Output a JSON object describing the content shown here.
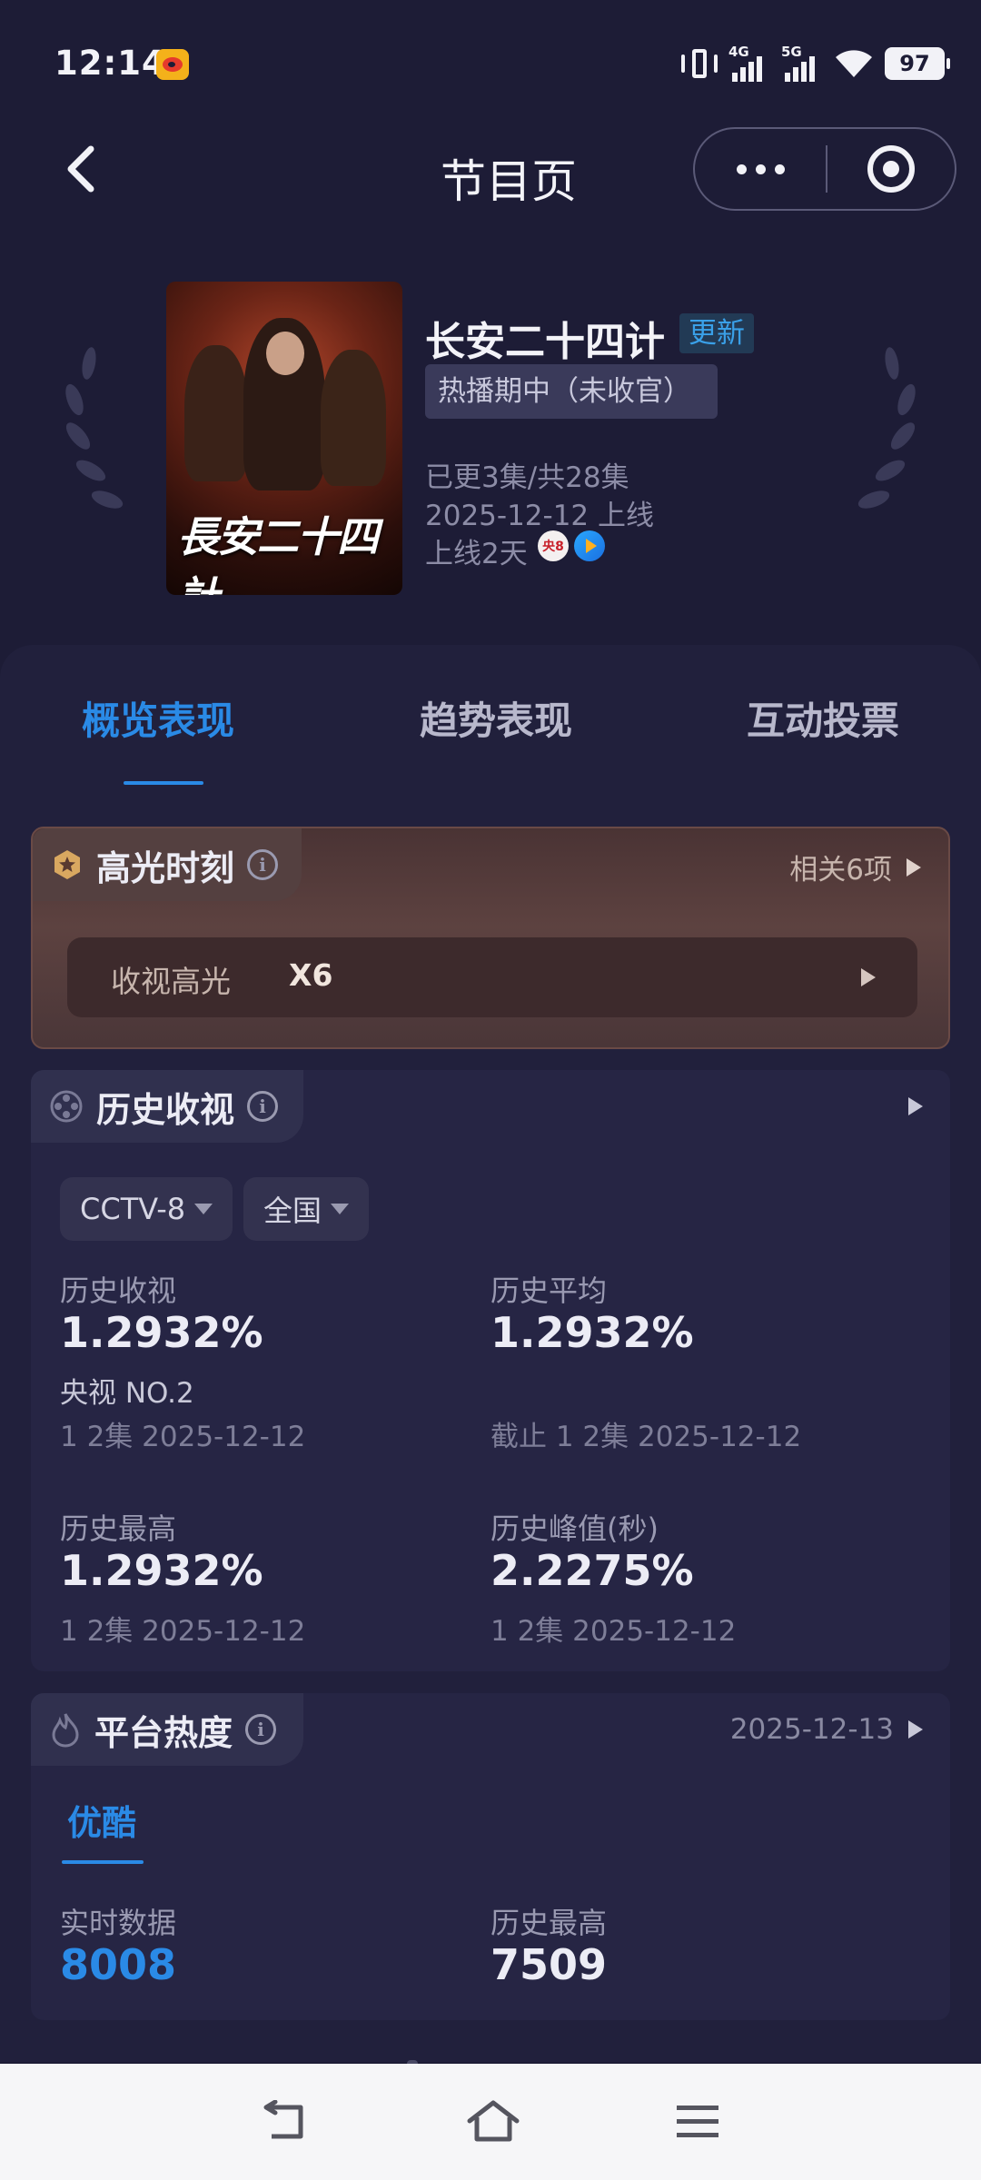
{
  "status_bar": {
    "time": "12:14",
    "signal_1_label": "4G",
    "signal_2_label": "5G",
    "battery": "97"
  },
  "header": {
    "title": "节目页"
  },
  "show": {
    "poster_title_art": "長安二十四計",
    "title": "长安二十四计",
    "update_badge": "更新",
    "status_tag": "热播期中（未收官）",
    "episodes": "已更3集/共28集",
    "premiere": "2025-12-12 上线",
    "days_online": "上线2天",
    "channel_badge": "央8"
  },
  "tabs": [
    {
      "label": "概览表现",
      "active": true
    },
    {
      "label": "趋势表现",
      "active": false
    },
    {
      "label": "互动投票",
      "active": false
    }
  ],
  "highlight": {
    "title": "高光时刻",
    "related": "相关6项",
    "row_label": "收视高光",
    "row_value": "X6"
  },
  "history": {
    "title": "历史收视",
    "channel": "CCTV-8",
    "region": "全国",
    "stats": [
      {
        "label": "历史收视",
        "value": "1.2932%",
        "rank": "央视 NO.2",
        "sub": "1 2集 2025-12-12"
      },
      {
        "label": "历史平均",
        "value": "1.2932%",
        "sub": "截止 1 2集 2025-12-12"
      },
      {
        "label": "历史最高",
        "value": "1.2932%",
        "sub": "1 2集 2025-12-12"
      },
      {
        "label": "历史峰值(秒)",
        "value": "2.2275%",
        "sub": "1 2集 2025-12-12"
      }
    ]
  },
  "platform": {
    "title": "平台热度",
    "date": "2025-12-13",
    "tab": "优酷",
    "realtime_label": "实时数据",
    "realtime_value": "8008",
    "max_label": "历史最高",
    "max_value": "7509"
  },
  "colors": {
    "background": "#1d1c36",
    "accent_blue": "#2a8ae6",
    "highlight_card": "#5d4240"
  }
}
